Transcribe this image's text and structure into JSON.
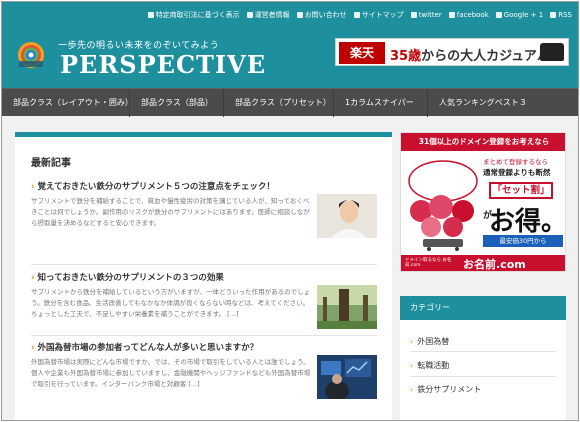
{
  "header": {
    "top_links": [
      {
        "icon": "list-icon",
        "label": "特定商取引法に基づく表示"
      },
      {
        "icon": "person-icon",
        "label": "運営者情報"
      },
      {
        "icon": "mail-icon",
        "label": "お問い合わせ"
      },
      {
        "icon": "sitemap-icon",
        "label": "サイトマップ"
      },
      {
        "icon": "twitter-icon",
        "label": "twitter"
      },
      {
        "icon": "facebook-icon",
        "label": "facebook"
      },
      {
        "icon": "google-plus-icon",
        "label": "Google + 1"
      },
      {
        "icon": "rss-icon",
        "label": "RSS"
      }
    ],
    "tagline": "一歩先の明るい未来をのぞいてみよう",
    "site_name": "PERSPECTIVE",
    "banner": {
      "logo_text": "楽天",
      "text_highlight": "35歳",
      "text_rest": "からの大人カジュアル"
    }
  },
  "nav": {
    "items": [
      "部品クラス（レイアウト・囲み）",
      "部品クラス（部品）",
      "部品クラス（プリセット）",
      "1カラムスナイパー",
      "人気ランキングベスト３"
    ]
  },
  "main": {
    "title": "最新記事",
    "articles": [
      {
        "title": "覚えておきたい鉄分のサプリメント５つの注意点をチェック！",
        "body": "サプリメントで鉄分を補給することで、貧血や慢性疲労の対策を講じている人が、知っておくべきことは何でしょうか。副作用のリスクが鉄分のサプリメントにはあります。医師に相談しながら摂取量を決めるなどすると安心できます。"
      },
      {
        "title": "知っておきたい鉄分のサプリメントの３つの効果",
        "body": "サプリメントから鉄分を補給しているという方がいますが、一体どういった作用があるのでしょう。鉄分を含む食品、生活改善してもなかなか体調が良くならない時などは、考えてください。ちょっとした工夫で、不足しやすい栄養素を補うことができます。 [...]"
      },
      {
        "title": "外国為替市場の参加者ってどんな人が多いと思いますか？",
        "body": "外国為替市場は実際にどんな市場ですか、では、その市場で取引をしている人とは誰でしょう。個人や企業も外国為替市場に参加していますし、金融機関やヘッジファンドなども外国為替市場で取引を行っています。インターバンク市場と対顧客 [...]"
      }
    ]
  },
  "sidebar": {
    "ad": {
      "top_text": "31個以上のドメイン登録をお考えなら",
      "circle_text": "まとめて登録するなら",
      "line1": "通常登録よりも断然",
      "box_text": "「セット割」",
      "line2": "が",
      "big_text": "お得。",
      "price_text": "最安価30円から",
      "small_text": "ドメイン取るなら お名前.com",
      "brand": "お名前.com"
    },
    "categories_title": "カテゴリー",
    "categories": [
      "外国為替",
      "転職活動",
      "鉄分サプリメント"
    ]
  },
  "colors": {
    "brand_teal": "#1d8f9d",
    "nav_bg": "#4b4b4b",
    "accent_orange": "#e08a00",
    "ad_red": "#c8102e"
  }
}
